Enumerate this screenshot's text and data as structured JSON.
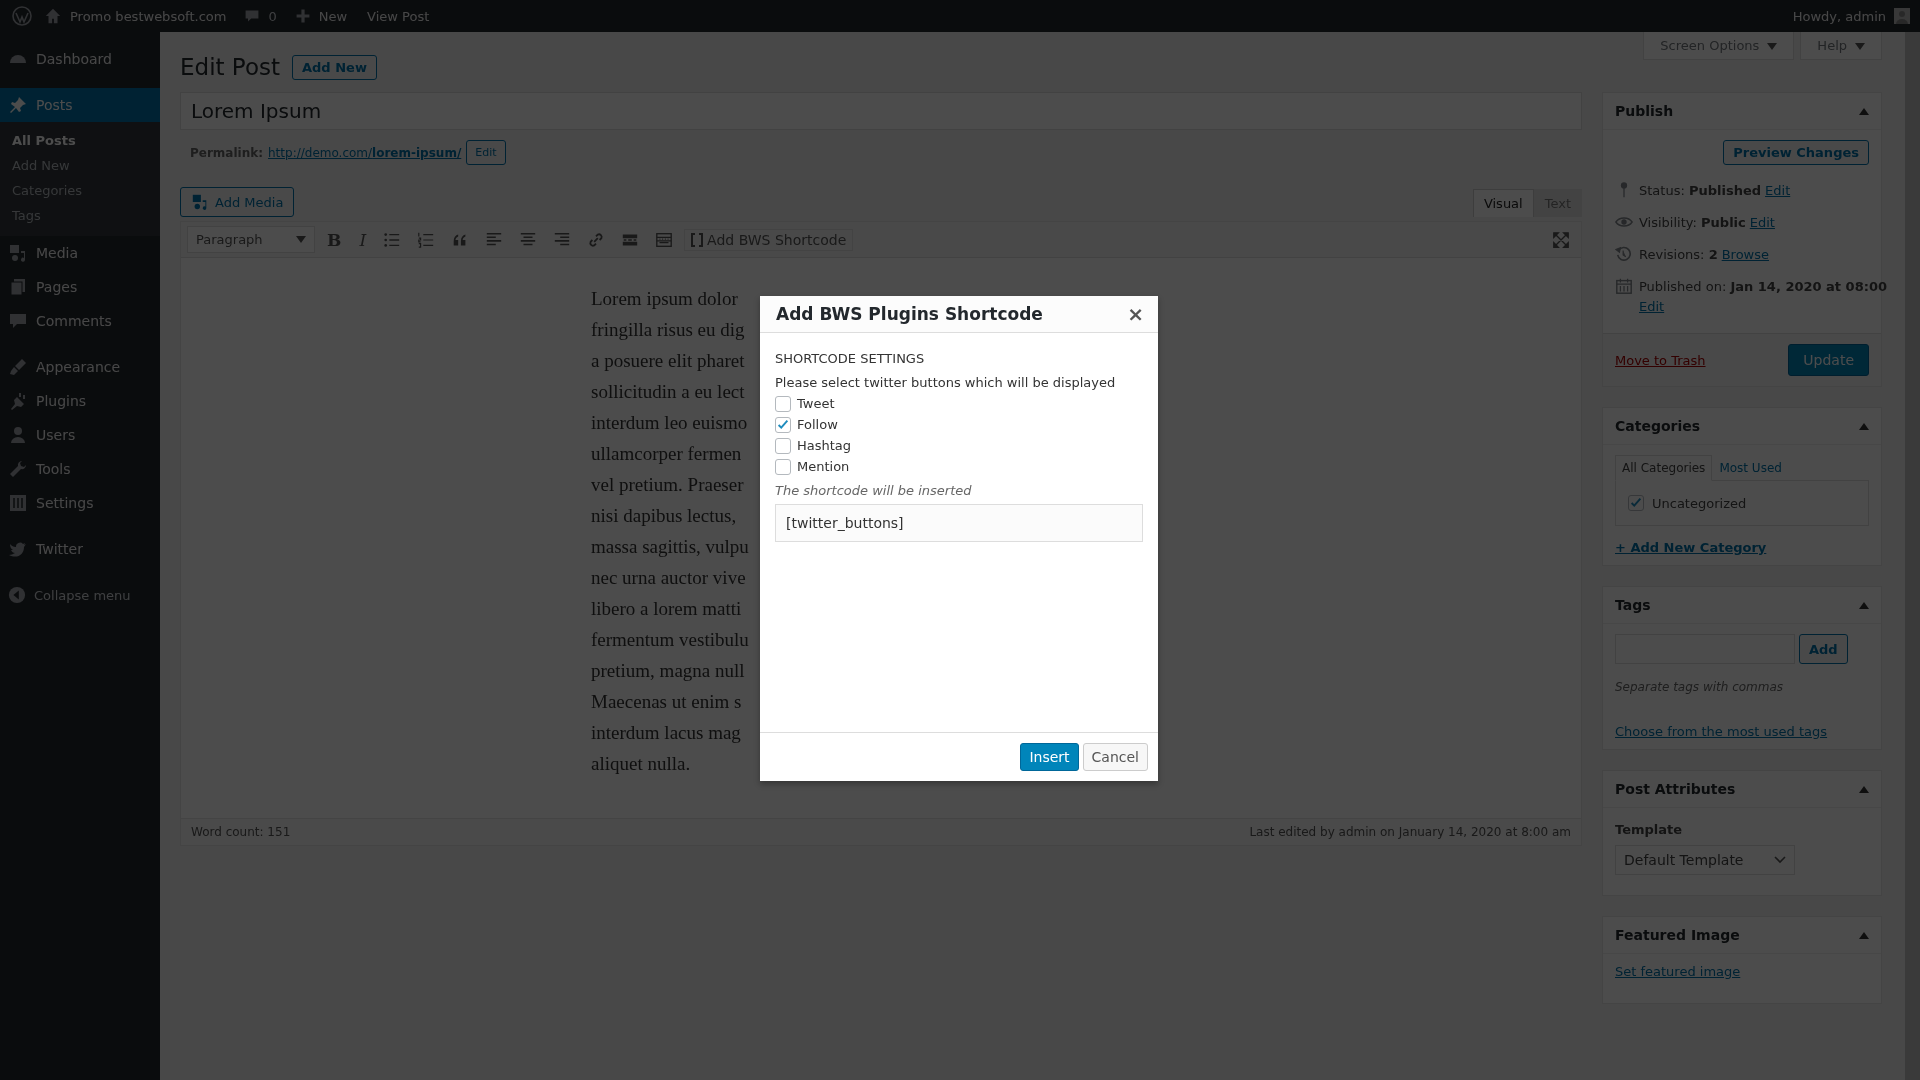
{
  "admin_bar": {
    "site": "Promo bestwebsoft.com",
    "comments": "0",
    "new": "New",
    "view": "View Post",
    "greeting": "Howdy, admin"
  },
  "menu_groups": [
    [
      {
        "label": "Dashboard",
        "selected": false
      }
    ],
    [
      {
        "label": "Posts",
        "selected": true,
        "children": [
          {
            "label": "All Posts",
            "selected": true
          },
          {
            "label": "Add New",
            "selected": false
          },
          {
            "label": "Categories",
            "selected": false
          },
          {
            "label": "Tags",
            "selected": false
          }
        ]
      },
      {
        "label": "Media",
        "selected": false
      },
      {
        "label": "Pages",
        "selected": false
      },
      {
        "label": "Comments",
        "selected": false
      }
    ],
    [
      {
        "label": "Appearance",
        "selected": false
      },
      {
        "label": "Plugins",
        "selected": false
      },
      {
        "label": "Users",
        "selected": false
      },
      {
        "label": "Tools",
        "selected": false
      },
      {
        "label": "Settings",
        "selected": false
      }
    ],
    [
      {
        "label": "Twitter",
        "selected": false
      }
    ]
  ],
  "collapse": "Collapse menu",
  "screen_options": "Screen Options",
  "help": "Help",
  "heading": "Edit Post",
  "add_new": "Add New",
  "title": "Lorem Ipsum",
  "permalink": {
    "label": "Permalink:",
    "url": "http://demo.com/",
    "slug": "lorem-ipsum/",
    "edit": "Edit"
  },
  "add_media": "Add Media",
  "editor_tabs": [
    {
      "label": "Visual",
      "selected": true
    },
    {
      "label": "Text",
      "selected": false
    }
  ],
  "toolbar": {
    "format": "Paragraph",
    "glyphs": [
      "B",
      "I"
    ],
    "shortcode": "Add BWS Shortcode"
  },
  "content_lines": [
    {
      "left": "Lorem ipsum dolor"
    },
    {
      "left": "fringilla risus eu dig"
    },
    {
      "left": "a posuere elit pharet"
    },
    {
      "left": "sollicitudin a eu lect"
    },
    {
      "left": "interdum leo euismo"
    },
    {
      "left": "ullamcorper fermen"
    },
    {
      "left": "vel pretium. Praeser"
    },
    {
      "left": "nisi dapibus lectus,"
    },
    {
      "left": "massa sagittis, vulpu"
    },
    {
      "left": "nec urna auctor vive"
    },
    {
      "left": "libero a lorem matti"
    },
    {
      "left": "fermentum vestibulu"
    },
    {
      "left": "pretium, magna null"
    },
    {
      "left": "Maecenas ut enim s"
    },
    {
      "left": "interdum lacus mag"
    },
    {
      "left": "aliquet nulla."
    }
  ],
  "word_count": "Word count: 151",
  "last_edited": "Last edited by admin on January 14, 2020 at 8:00 am",
  "publish": {
    "title": "Publish",
    "preview": "Preview Changes",
    "rows": [
      {
        "text": "Status: **Published**",
        "link": "Edit"
      },
      {
        "text": "Visibility: **Public**",
        "link": "Edit"
      },
      {
        "text": "Revisions: **2**",
        "link": "Browse"
      },
      {
        "text": "Published on: **Jan 14, 2020 at 08:00**",
        "link": "Edit"
      }
    ],
    "trash": "Move to Trash",
    "update": "Update"
  },
  "categories": {
    "title": "Categories",
    "tabs": [
      {
        "label": "All Categories",
        "selected": true
      },
      {
        "label": "Most Used",
        "selected": false
      }
    ],
    "items": [
      {
        "label": "Uncategorized",
        "checked": true
      }
    ],
    "add": "+ Add New Category"
  },
  "tags": {
    "title": "Tags",
    "add": "Add",
    "hint": "Separate tags with commas",
    "choose": "Choose from the most used tags"
  },
  "attributes": {
    "title": "Post Attributes",
    "template_label": "Template",
    "template": "Default Template"
  },
  "featured": {
    "title": "Featured Image",
    "link": "Set featured image"
  },
  "modal": {
    "title": "Add BWS Plugins Shortcode",
    "close": "×",
    "section": "SHORTCODE SETTINGS",
    "prompt": "Please select twitter buttons which will be displayed",
    "options": [
      {
        "label": "Tweet",
        "checked": false
      },
      {
        "label": "Follow",
        "checked": true
      },
      {
        "label": "Hashtag",
        "checked": false
      },
      {
        "label": "Mention",
        "checked": false
      }
    ],
    "note": "The shortcode will be inserted",
    "shortcode": "[twitter_buttons]",
    "insert": "Insert",
    "cancel": "Cancel"
  }
}
